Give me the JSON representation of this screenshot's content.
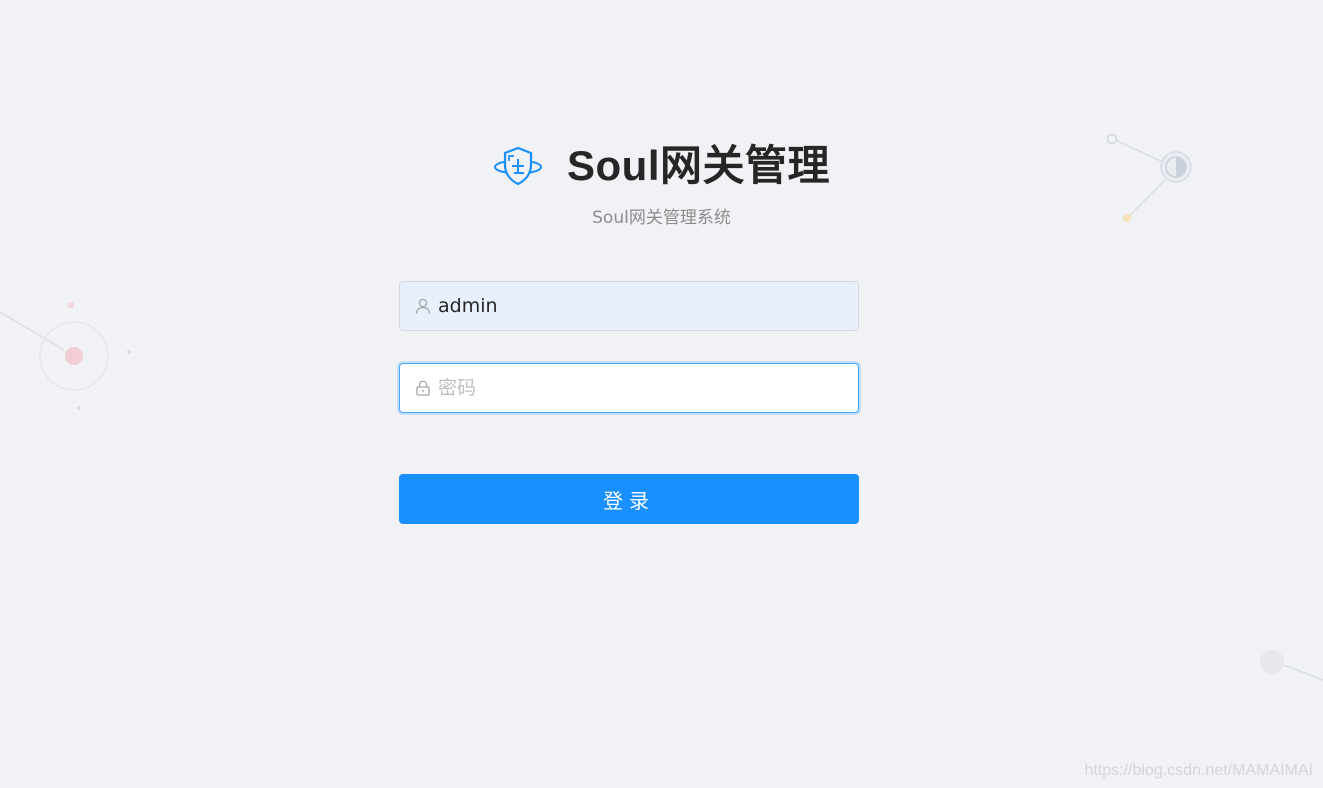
{
  "app": {
    "title": "Soul网关管理",
    "subtitle": "Soul网关管理系统"
  },
  "form": {
    "username": {
      "value": "admin",
      "icon": "user-icon"
    },
    "password": {
      "value": "",
      "placeholder": "密码",
      "icon": "lock-icon"
    },
    "submit_label": "登录"
  },
  "watermark": "https://blog.csdn.net/MAMAIMAI",
  "colors": {
    "background": "#f0f2f5",
    "primary": "#1890ff",
    "autofill_bg": "#e8f0fe",
    "logo": "#1890ff"
  }
}
